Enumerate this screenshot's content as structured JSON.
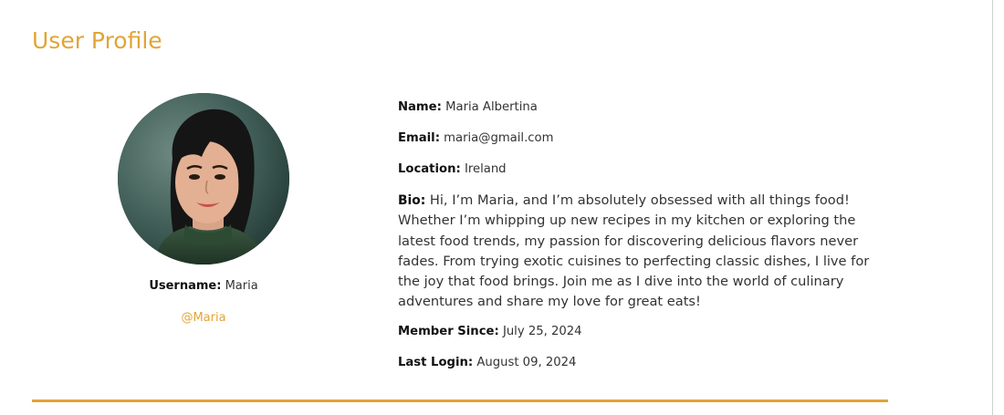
{
  "page": {
    "title": "User Profile"
  },
  "profile": {
    "avatar_alt": "Profile photo of Maria",
    "username_label": "Username:",
    "username": "Maria",
    "handle": "@Maria",
    "fields": {
      "name_label": "Name:",
      "name": "Maria Albertina",
      "email_label": "Email:",
      "email": "maria@gmail.com",
      "location_label": "Location:",
      "location": "Ireland",
      "bio_label": "Bio:",
      "bio": "Hi, I’m Maria, and I’m absolutely obsessed with all things food! Whether I’m whipping up new recipes in my kitchen or exploring the latest food trends, my passion for discovering delicious flavors never fades. From trying exotic cuisines to perfecting classic dishes, I live for the joy that food brings. Join me as I dive into the world of culinary adventures and share my love for great eats!",
      "member_since_label": "Member Since:",
      "member_since": "July 25, 2024",
      "last_login_label": "Last Login:",
      "last_login": "August 09, 2024"
    }
  },
  "colors": {
    "accent": "#e0a537",
    "text": "#333333",
    "label": "#111111"
  }
}
